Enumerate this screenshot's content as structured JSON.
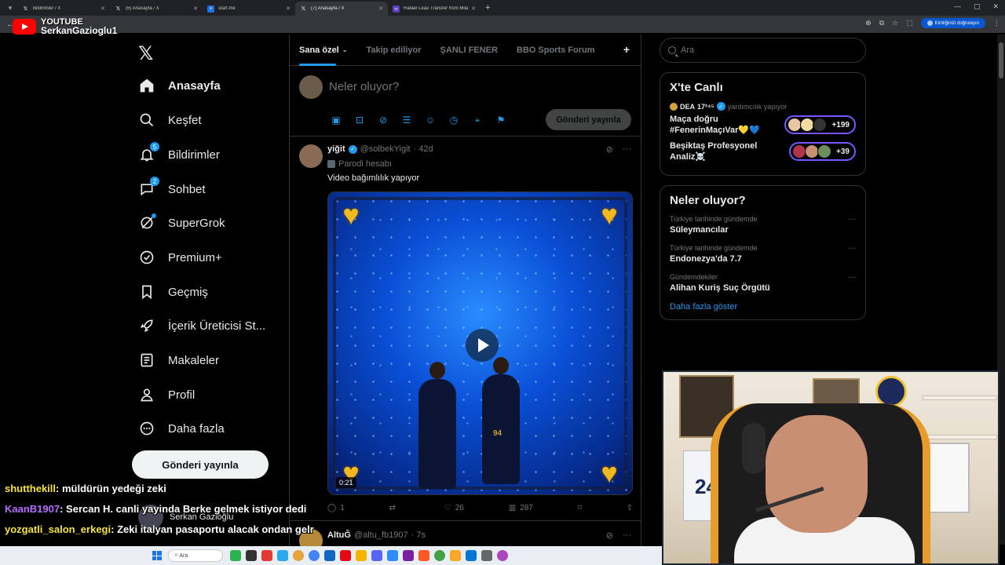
{
  "browser": {
    "tabs": [
      {
        "title": "Bildirimler / X",
        "favicon": "x-icon"
      },
      {
        "title": "(6) Anasayfa / X",
        "favicon": "x-icon"
      },
      {
        "title": "start.me",
        "favicon": "startme-icon"
      },
      {
        "title": "(7) Anasayfa / X",
        "favicon": "x-icon",
        "active": true
      },
      {
        "title": "Rafael Leão Transfer from Mila...",
        "favicon": "tf-icon"
      }
    ],
    "verify_label": "Kimliğinizi doğrulayın"
  },
  "stream": {
    "platform": "YOUTUBE",
    "channel": "SerkanGazioglu1"
  },
  "sidebar": {
    "items": [
      {
        "label": "Anasayfa",
        "icon": "home-icon",
        "active": true
      },
      {
        "label": "Keşfet",
        "icon": "search-icon"
      },
      {
        "label": "Bildirimler",
        "icon": "bell-icon",
        "badge": "5"
      },
      {
        "label": "Sohbet",
        "icon": "chat-icon",
        "badge": "2"
      },
      {
        "label": "SuperGrok",
        "icon": "grok-icon",
        "dot": true
      },
      {
        "label": "Premium+",
        "icon": "verified-icon"
      },
      {
        "label": "Geçmiş",
        "icon": "bookmark-icon"
      },
      {
        "label": "İçerik Üreticisi St...",
        "icon": "rocket-icon"
      },
      {
        "label": "Makaleler",
        "icon": "article-icon"
      },
      {
        "label": "Profil",
        "icon": "person-icon"
      },
      {
        "label": "Daha fazla",
        "icon": "more-circle-icon"
      }
    ],
    "post_button": "Gönderi yayınla",
    "account_name": "Serkan Gazioğlu"
  },
  "main": {
    "tabs": [
      {
        "label": "Sana özel",
        "active": true
      },
      {
        "label": "Takip ediliyor"
      },
      {
        "label": "ŞANLI FENER"
      },
      {
        "label": "BBO Sports Forum"
      }
    ],
    "composer": {
      "placeholder": "Neler oluyor?",
      "submit": "Gönderi yayınla"
    },
    "tweet": {
      "name": "yiğit",
      "handle": "@solbekYigit",
      "time": "· 42d",
      "parody_label": "Parodi hesabı",
      "text": "Video bağımlılık yapıyor",
      "video_duration": "0:21",
      "player_numbers": [
        "94"
      ],
      "stats": {
        "replies": "1",
        "retweets": "",
        "likes": "26",
        "views": "287"
      }
    },
    "tweet2": {
      "name": "AltuĞ",
      "handle": "@altu_fb1907",
      "time": "· 7s"
    }
  },
  "right": {
    "search_placeholder": "Ara",
    "live": {
      "title": "X'te Canlı",
      "host_name": "DEA",
      "host_sup": "17²⁴⁵",
      "host_status": "yardımcılık yapıyor",
      "items": [
        {
          "title": "Maça doğru #FenerinMaçıVar💛💙",
          "count": "+199"
        },
        {
          "title": "Beşiktaş Profesyonel Analiz☠️",
          "count": "+39"
        }
      ]
    },
    "trends": {
      "title": "Neler oluyor?",
      "items": [
        {
          "context": "Türkiye tarihinde gündemde",
          "title": "Süleymancılar"
        },
        {
          "context": "Türkiye tarihinde gündemde",
          "title": "Endonezya'da 7.7"
        },
        {
          "context": "Gündemdekiler",
          "title": "Alihan Kuriş Suç Örgütü"
        }
      ],
      "show_more": "Daha fazla göster"
    }
  },
  "chat": [
    {
      "user": "shutthekill",
      "color": "#f7e43b",
      "message": ": müldürün yedeği zeki"
    },
    {
      "user": "KaanB1907",
      "color": "#b66dff",
      "message": ": Sercan H. canli yayinda Berke gelmek istiyor dedi"
    },
    {
      "user": "yozgatli_salon_erkegi",
      "color": "#f7e43b",
      "message": ": Zeki italyan pasaportu alacak ondan gelr"
    }
  ],
  "taskbar": {
    "search": "Ara"
  },
  "colors": {
    "accent": "#1d9bf0",
    "live_ring": "#7856ff",
    "background": "#000000"
  }
}
